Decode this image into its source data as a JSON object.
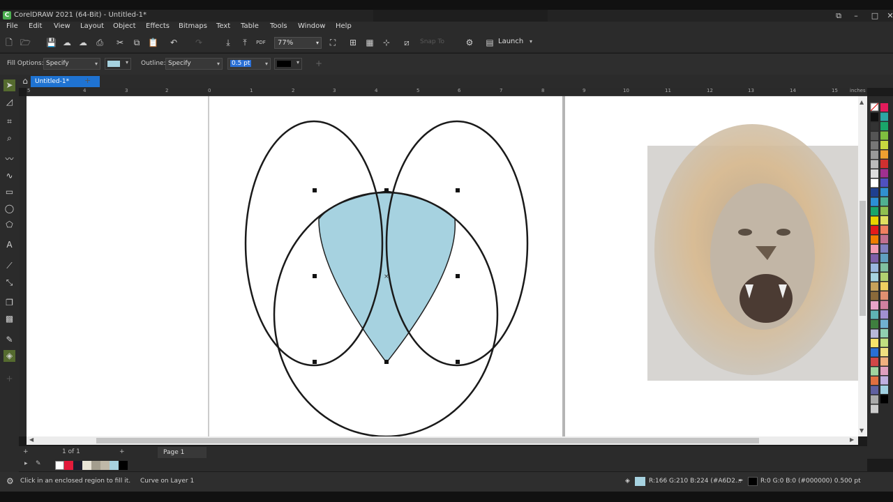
{
  "window": {
    "title": "CorelDRAW 2021 (64-Bit) - Untitled-1*"
  },
  "menu": [
    "File",
    "Edit",
    "View",
    "Layout",
    "Object",
    "Effects",
    "Bitmaps",
    "Text",
    "Table",
    "Tools",
    "Window",
    "Help"
  ],
  "toolbar": {
    "zoom": "77%",
    "snap_to": "Snap To",
    "launch": "Launch"
  },
  "property_bar": {
    "fill_options_label": "Fill Options:",
    "fill_mode": "Specify",
    "fill_color": "#a6d2e0",
    "outline_label": "Outline:",
    "outline_mode": "Specify",
    "outline_width": "0.5 pt",
    "outline_color": "#000000"
  },
  "document": {
    "tab": "Untitled-1*",
    "ruler_units": "inches",
    "ruler_ticks": [
      "5",
      "4",
      "3",
      "2",
      "1",
      "0",
      "1",
      "2",
      "3",
      "4",
      "5",
      "6",
      "7",
      "8",
      "9",
      "10",
      "11",
      "12",
      "13",
      "14",
      "15"
    ]
  },
  "page_nav": {
    "count": "1 of 1",
    "page_tab": "Page 1"
  },
  "status": {
    "hint": "Click in an enclosed region to fill it.",
    "object": "Curve on Layer 1",
    "fill_info": "R:166 G:210 B:224 (#A6D2...",
    "outline_info": "R:0 G:0 B:0 (#000000)  0.500 pt"
  },
  "icons": {
    "pick": "pointer-icon",
    "shape": "shape-edit-icon",
    "crop": "crop-icon",
    "zoom": "zoom-icon",
    "freehand": "freehand-icon",
    "bezier": "bezier-icon",
    "rectangle": "rectangle-icon",
    "ellipse": "ellipse-icon",
    "polygon": "polygon-icon",
    "text": "text-icon",
    "connector": "connector-icon",
    "blend": "blend-icon",
    "shadow": "shadow-icon",
    "transparency": "transparency-icon",
    "eyedropper": "eyedropper-icon",
    "smart_fill": "smart-fill-icon"
  }
}
